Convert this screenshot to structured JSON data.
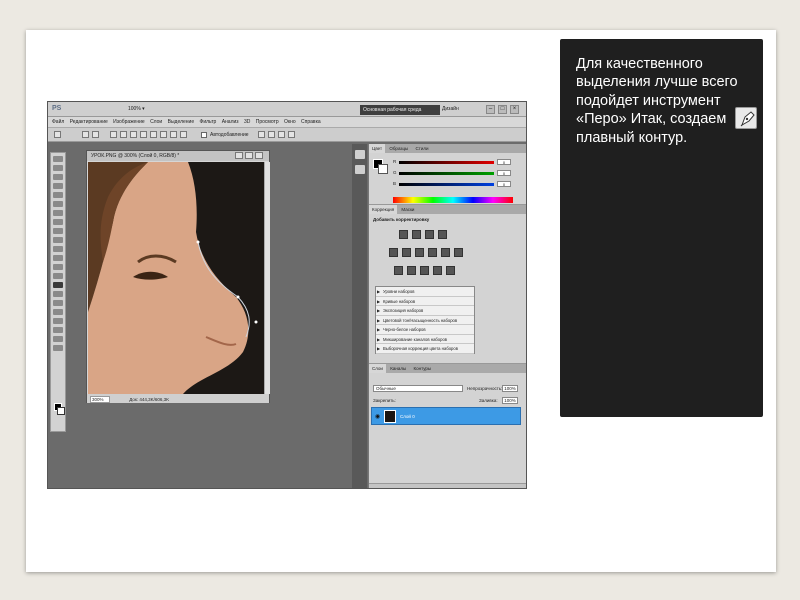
{
  "photoshop": {
    "logo": "PS",
    "zoom_readout": "100% ▾",
    "workspace_label": "Основная рабочая среда",
    "design_label": "Дизайн",
    "window_controls": [
      "–",
      "□",
      "×"
    ],
    "menu": [
      "Файл",
      "Редактирование",
      "Изображение",
      "Слои",
      "Выделение",
      "Фильтр",
      "Анализ",
      "3D",
      "Просмотр",
      "Окно",
      "Справка"
    ],
    "options_bar": {
      "auto_add_label": "Автодобавление"
    },
    "document": {
      "title": "УРОК.PNG @ 300% (Слой 0, RGB/8) *",
      "zoom": "300%",
      "doc_size": "Док: 444,3K/606,3K"
    },
    "color_panel": {
      "tabs": [
        "Цвет",
        "Образцы",
        "Стили"
      ],
      "channels": [
        {
          "label": "R",
          "value": "0",
          "color": "#e00000"
        },
        {
          "label": "G",
          "value": "0",
          "color": "#00a000"
        },
        {
          "label": "B",
          "value": "0",
          "color": "#0040e0"
        }
      ]
    },
    "adjust_panel": {
      "tabs": [
        "Коррекция",
        "Маски"
      ],
      "title": "Добавить корректировку",
      "presets": [
        "Уровни наборов",
        "Кривые наборов",
        "Экспозиция наборов",
        "Цветовой тон/Насыщенность наборов",
        "Черно-белое наборов",
        "Микширование каналов наборов",
        "Выборочная коррекция цвета наборов"
      ]
    },
    "layers_panel": {
      "tabs": [
        "Слои",
        "Каналы",
        "Контуры"
      ],
      "blend_mode": "Обычные",
      "opacity_label": "Непрозрачность:",
      "opacity_value": "100%",
      "lock_label": "Закрепить:",
      "fill_label": "Заливка:",
      "fill_value": "100%",
      "layer_name": "Слой 0"
    }
  },
  "caption": {
    "text": "Для качественного выделения лучше всего подойдет инструмент «Перо» Итак, создаем плавный контур.",
    "icon": "pen-tool-icon"
  },
  "colors": {
    "caption_bg": "#1f1f1f",
    "layer_selected": "#3d9ae5",
    "canvas_bg": "#6b6b6b"
  }
}
